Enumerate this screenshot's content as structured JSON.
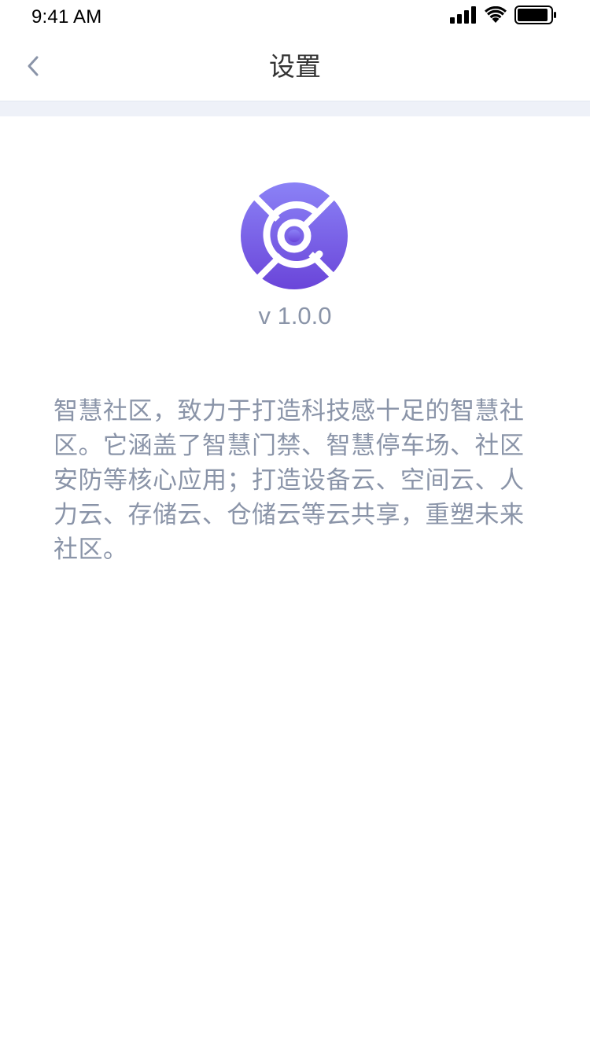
{
  "status_bar": {
    "time": "9:41 AM",
    "icons": [
      "signal-icon",
      "wifi-icon",
      "battery-icon"
    ]
  },
  "nav": {
    "back_icon": "chevron-left-icon",
    "title": "设置"
  },
  "about": {
    "logo_icon": "app-logo-icon",
    "version": "v 1.0.0",
    "description": "智慧社区，致力于打造科技感十足的智慧社区。它涵盖了智慧门禁、智慧停车场、社区安防等核心应用；打造设备云、空间云、人力云、存储云、仓储云等云共享，重塑未来社区。"
  },
  "colors": {
    "title_text": "#333333",
    "secondary_text": "#8a94a8",
    "divider_band": "#eef1f8",
    "logo_gradient_top": "#8b82f6",
    "logo_gradient_bottom": "#6a45d9"
  }
}
